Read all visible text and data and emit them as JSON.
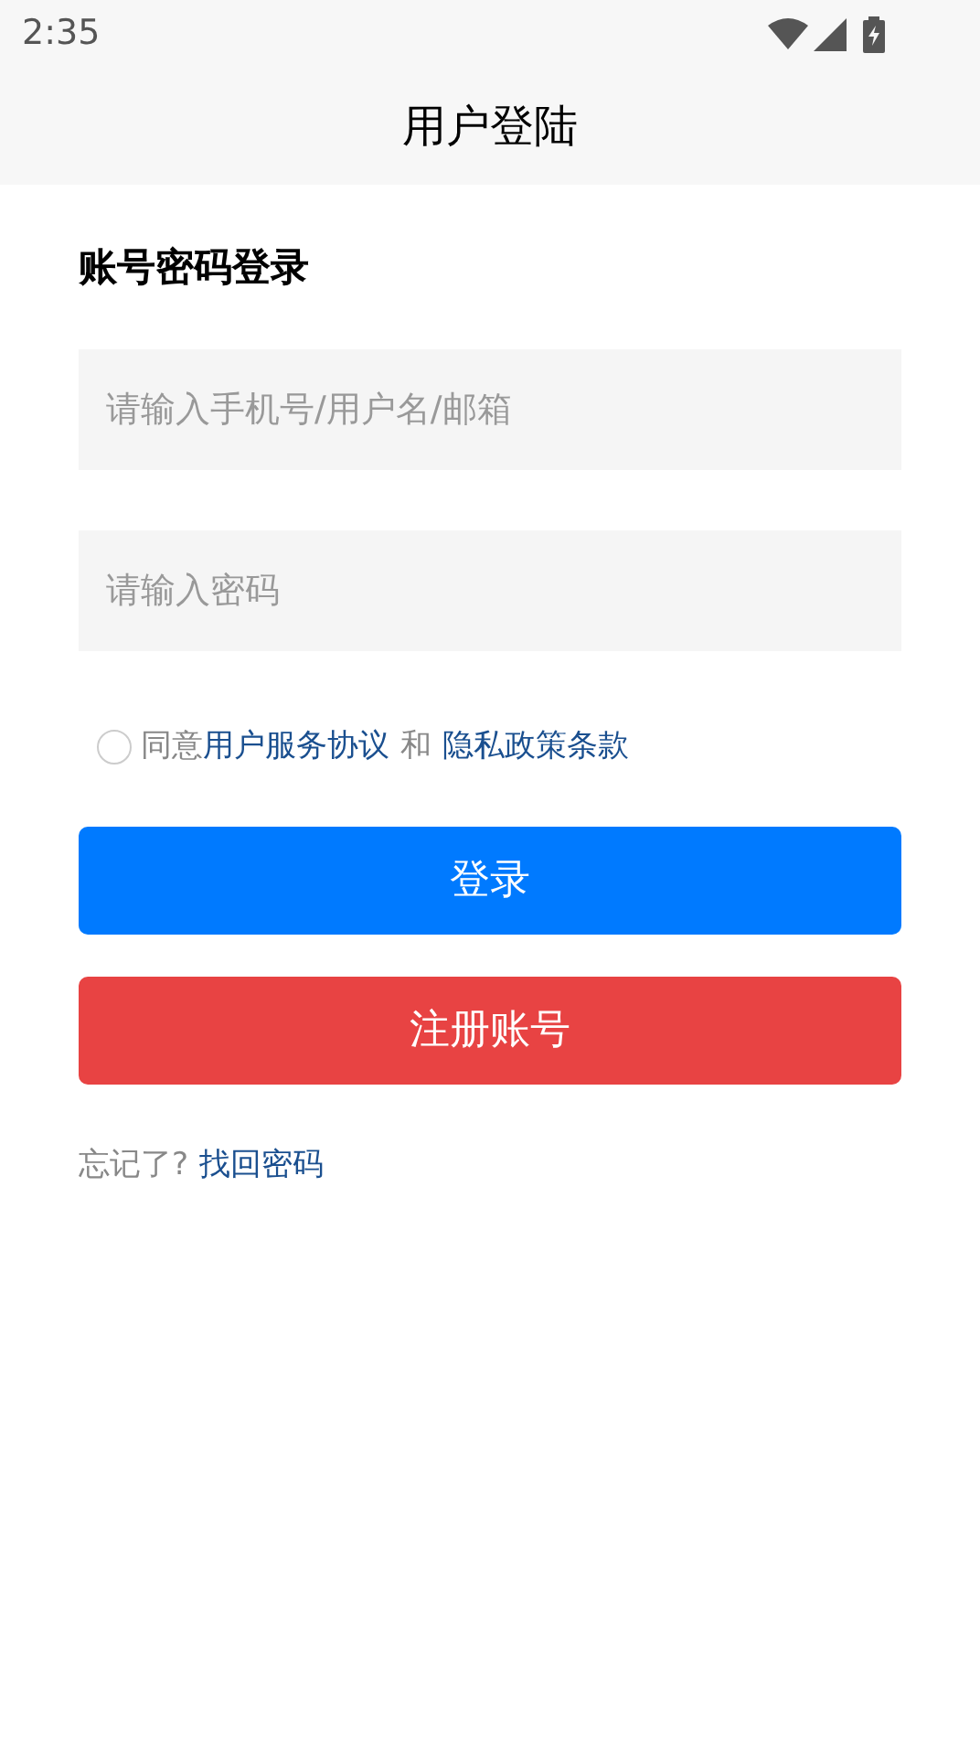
{
  "status_bar": {
    "time": "2:35"
  },
  "header": {
    "title": "用户登陆"
  },
  "form": {
    "heading": "账号密码登录",
    "fields": [
      {
        "placeholder": "请输入手机号/用户名/邮箱"
      },
      {
        "placeholder": "请输入密码"
      }
    ],
    "agreement": {
      "checked": false,
      "prefix": "同意",
      "link_1": "用户服务协议",
      "joiner": "和",
      "link_2": "隐私政策条款"
    },
    "buttons": [
      {
        "label": "登录",
        "kind": "primary"
      },
      {
        "label": "注册账号",
        "kind": "danger"
      }
    ],
    "forgot": {
      "text": "忘记了?",
      "link": "找回密码"
    }
  }
}
